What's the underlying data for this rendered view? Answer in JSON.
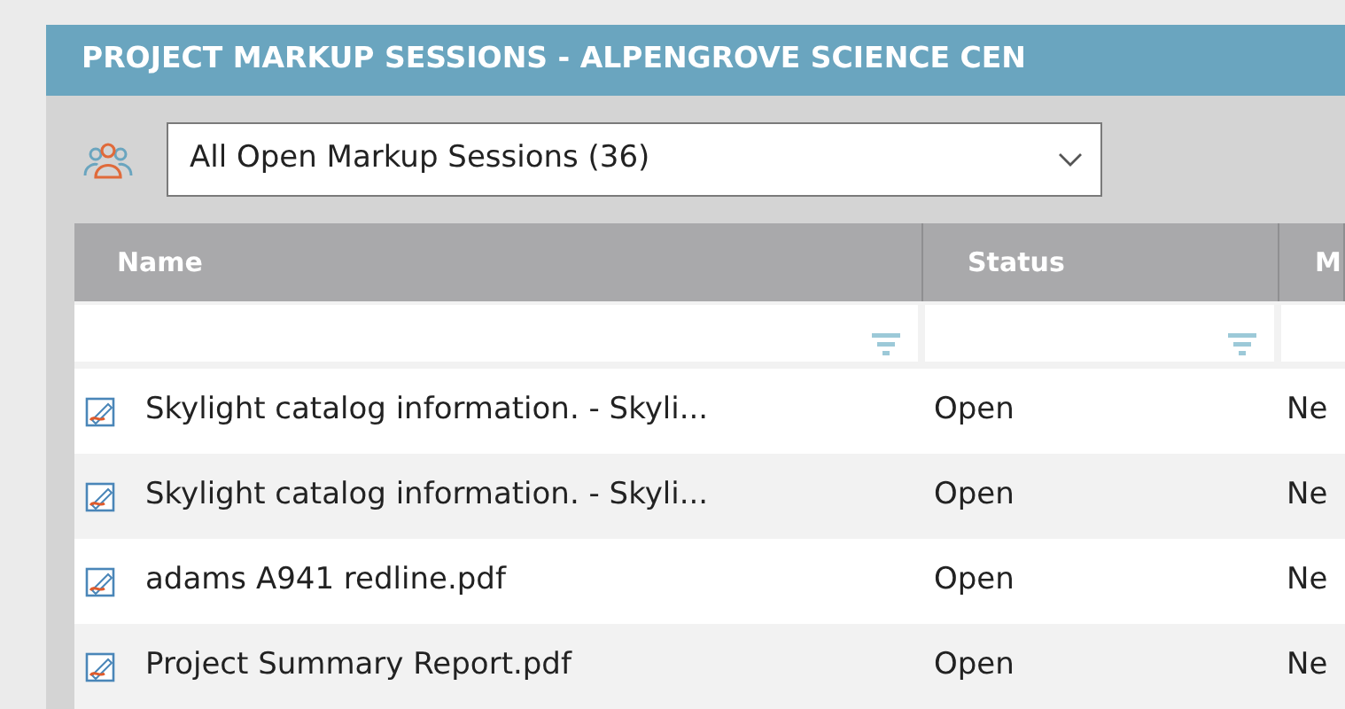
{
  "panel": {
    "title": "PROJECT MARKUP SESSIONS - ALPENGROVE SCIENCE CEN"
  },
  "session_filter": {
    "value": "All Open Markup Sessions (36)"
  },
  "table": {
    "columns": [
      "Name",
      "Status",
      "M"
    ],
    "rows": [
      {
        "name": "Skylight catalog information. - Skyli...",
        "status": "Open",
        "column_3": "Ne"
      },
      {
        "name": "Skylight catalog information. - Skyli...",
        "status": "Open",
        "column_3": "Ne"
      },
      {
        "name": "adams A941 redline.pdf",
        "status": "Open",
        "column_3": "Ne"
      },
      {
        "name": "Project Summary Report.pdf",
        "status": "Open",
        "column_3": "Ne"
      }
    ]
  }
}
